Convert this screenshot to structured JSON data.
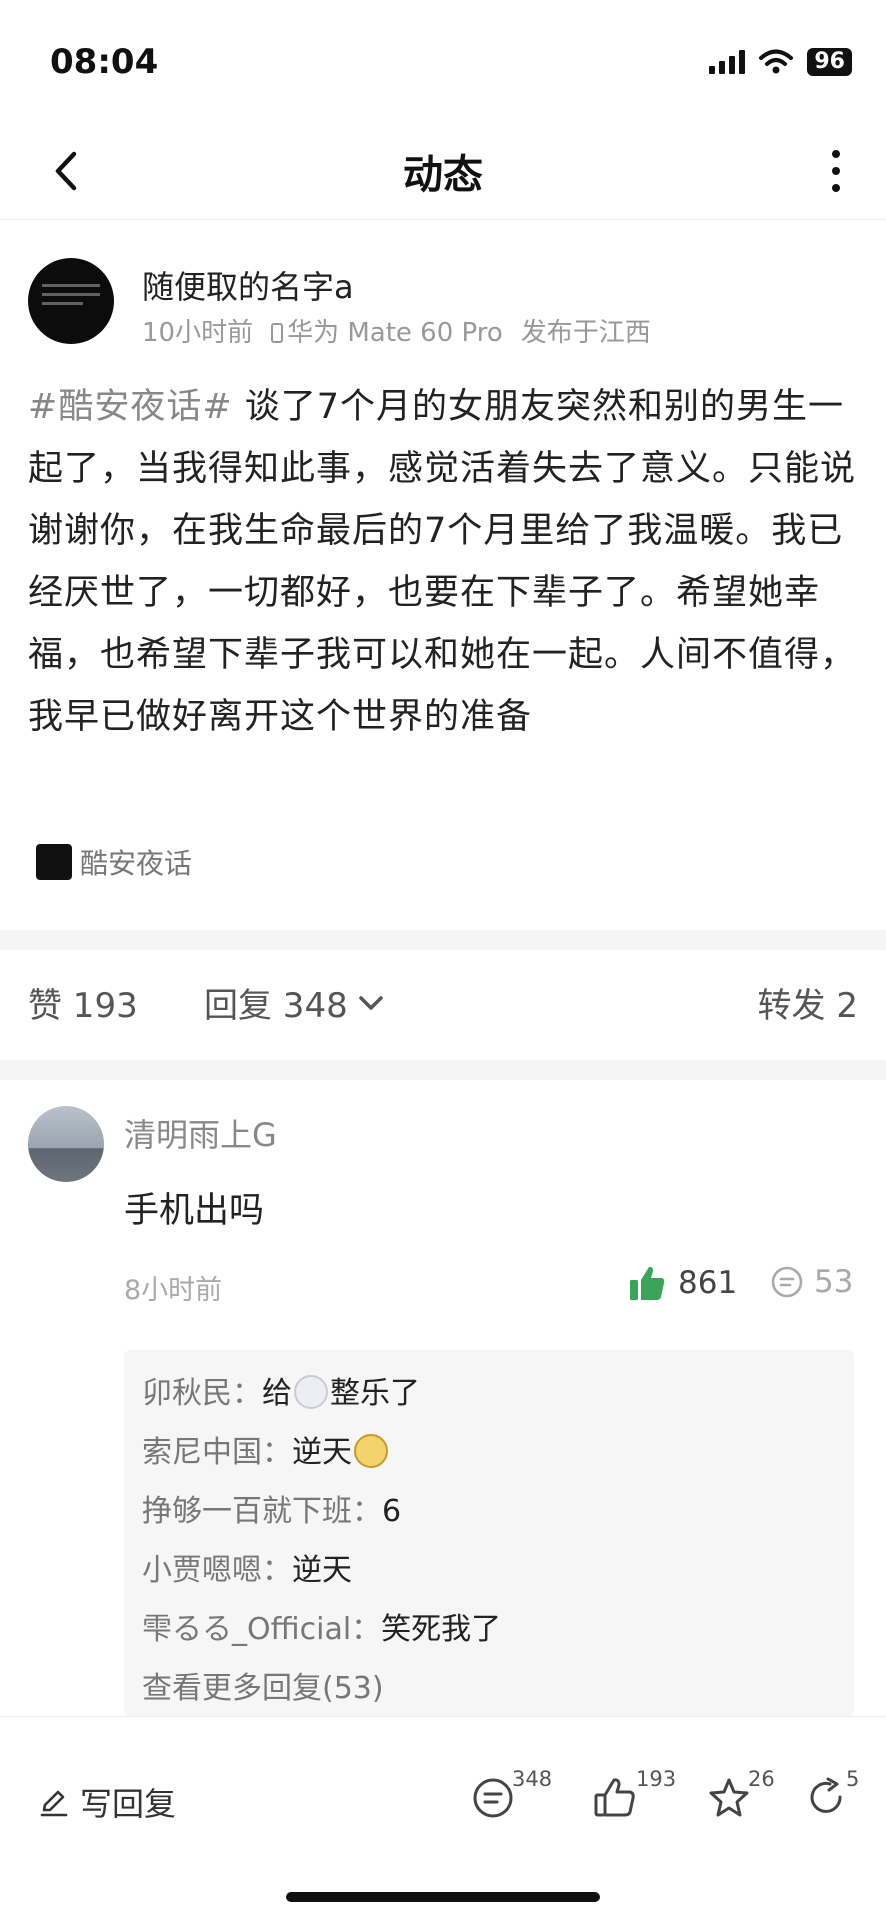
{
  "status_bar": {
    "time": "08:04",
    "battery": "96",
    "icons": [
      "signal-icon",
      "wifi-icon",
      "battery-icon"
    ]
  },
  "nav": {
    "title": "动态",
    "back_icon": "back-arrow-icon",
    "more_icon": "more-vertical-icon"
  },
  "post": {
    "author": "随便取的名字a",
    "time": "10小时前",
    "device": "华为 Mate 60 Pro",
    "location": "发布于江西",
    "hashtag": "#酷安夜话#",
    "body": " 谈了7个月的女朋友突然和别的男生一起了，当我得知此事，感觉活着失去了意义。只能说谢谢你，在我生命最后的7个月里给了我温暖。我已经厌世了，一切都好，也要在下辈子了。希望她幸福，也希望下辈子我可以和她在一起。人间不值得，我早已做好离开这个世界的准备",
    "topic": "酷安夜话"
  },
  "stats": {
    "like_label": "赞 193",
    "reply_label": "回复 348",
    "forward_label": "转发 2"
  },
  "comment": {
    "author": "清明雨上G",
    "text": "手机出吗",
    "time": "8小时前",
    "likes": "861",
    "replies": "53",
    "sub_replies": [
      {
        "user": "卯秋民：",
        "text": "给",
        "emoji": "smiling-face-emoji",
        "text_after": "整乐了"
      },
      {
        "user": "索尼中国：",
        "text": "逆天",
        "emoji": "sunglasses-emoji",
        "text_after": ""
      },
      {
        "user": "挣够一百就下班：",
        "text": "6",
        "emoji": "",
        "text_after": ""
      },
      {
        "user": "小贾嗯嗯：",
        "text": "逆天",
        "emoji": "",
        "text_after": ""
      },
      {
        "user": "雫るる_Official：",
        "text": "笑死我了",
        "emoji": "",
        "text_after": ""
      }
    ],
    "more_replies": "查看更多回复(53)"
  },
  "bottom_bar": {
    "write_reply": "写回复",
    "reply_count": "348",
    "like_count": "193",
    "star_count": "26",
    "share_count": "5"
  },
  "colors": {
    "like_green": "#3aa55a",
    "muted_text": "#999999",
    "sub_reply_bg": "#f6f6f6"
  }
}
